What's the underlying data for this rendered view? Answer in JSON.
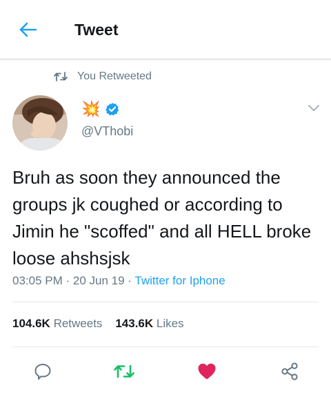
{
  "header": {
    "title": "Tweet"
  },
  "context": {
    "retweet_label": "You Retweeted"
  },
  "author": {
    "emoji_name": "💥",
    "handle": "@VThobi"
  },
  "tweet": {
    "text": "Bruh as soon they announced the groups jk coughed or according to Jimin he \"scoffed\" and all HELL broke loose ahshsjsk",
    "time": "03:05 PM",
    "sep1": " · ",
    "date": "20 Jun 19",
    "sep2": " · ",
    "source": "Twitter for Iphone"
  },
  "stats": {
    "retweets_count": "104.6K",
    "retweets_label": "Retweets",
    "likes_count": "143.6K",
    "likes_label": "Likes"
  },
  "icons": {
    "back": "arrow-left-icon",
    "retweet_context": "retweet-icon",
    "verified": "verified-badge-icon",
    "menu": "chevron-down-icon",
    "reply": "comment-bubble-icon",
    "retweet": "retweet-icon",
    "like": "heart-icon",
    "share": "share-icon"
  },
  "colors": {
    "accent": "#1da1f2",
    "retweeted": "#17bf63",
    "liked": "#e0245e",
    "secondary_text": "#657786",
    "primary_text": "#14171a"
  }
}
